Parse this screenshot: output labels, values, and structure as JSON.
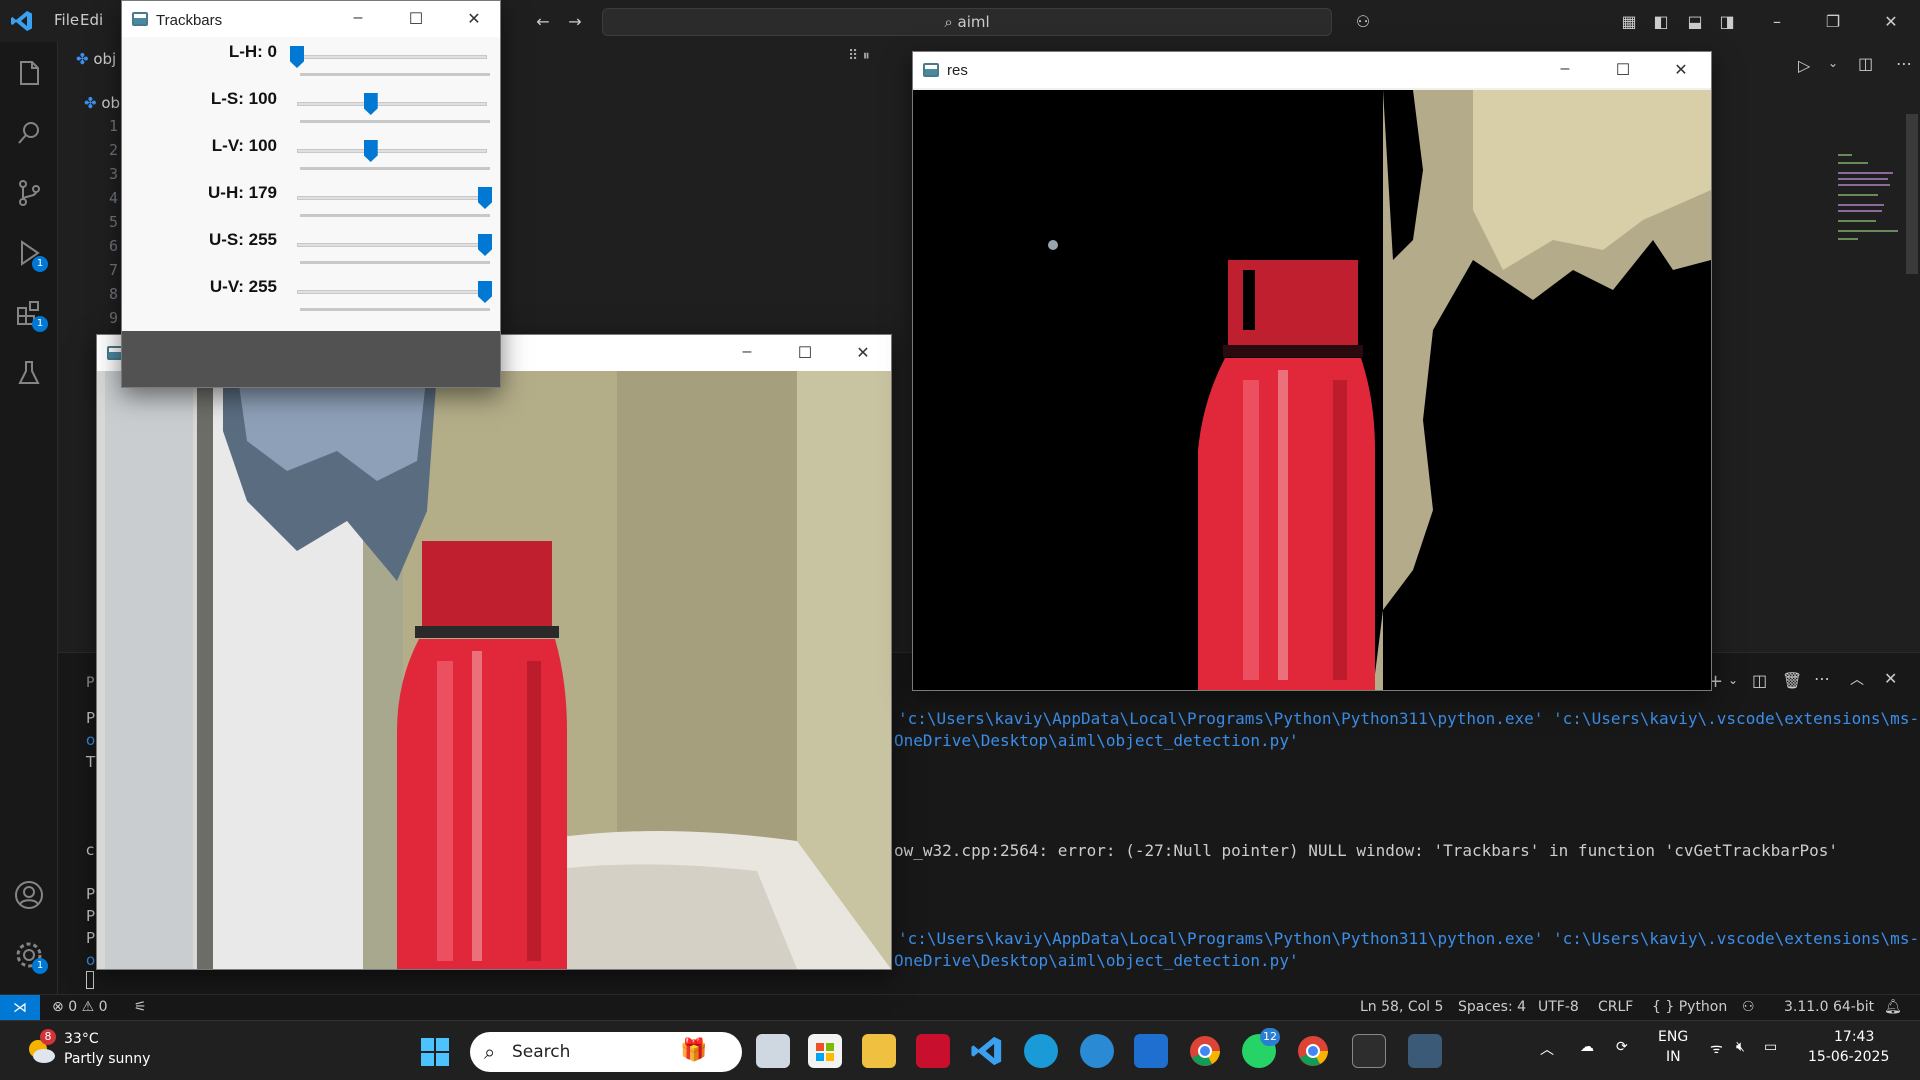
{
  "vscode": {
    "menu": [
      "File",
      "Edi"
    ],
    "search": "aiml",
    "tab_partial": "obj",
    "explorer_partial": "ob",
    "line_numbers": [
      "1",
      "2",
      "3",
      "4",
      "5",
      "6",
      "7",
      "8",
      "9"
    ],
    "badges": {
      "debug": "1",
      "extensions": "1",
      "settings": "1"
    },
    "panel_left_letters": [
      "P",
      "P",
      "o",
      "T",
      "c",
      "P",
      "P",
      "P",
      "o"
    ],
    "terminal": {
      "line1": "'c:\\Users\\kaviy\\AppData\\Local\\Programs\\Python\\Python311\\python.exe' 'c:\\Users\\kaviy\\.vscode\\extensions\\ms-pyth",
      "line2": "OneDrive\\Desktop\\aiml\\object_detection.py'",
      "error": "ow_w32.cpp:2564: error: (-27:Null pointer) NULL window: 'Trackbars' in function 'cvGetTrackbarPos'",
      "line3": "'c:\\Users\\kaviy\\AppData\\Local\\Programs\\Python\\Python311\\python.exe' 'c:\\Users\\kaviy\\.vscode\\extensions\\ms-pyth",
      "line4": "OneDrive\\Desktop\\aiml\\object_detection.py'"
    },
    "status": {
      "errors": "0",
      "warnings": "0",
      "position": "Ln 58, Col 5",
      "spaces": "Spaces: 4",
      "encoding": "UTF-8",
      "eol": "CRLF",
      "language": "{ } Python",
      "interpreter": "3.11.0 64-bit"
    }
  },
  "trackbars_window": {
    "title": "Trackbars",
    "sliders": [
      {
        "label": "L-H: 0",
        "value": 0,
        "max": 179
      },
      {
        "label": "L-S: 100",
        "value": 100,
        "max": 255
      },
      {
        "label": "L-V: 100",
        "value": 100,
        "max": 255
      },
      {
        "label": "U-H: 179",
        "value": 179,
        "max": 179
      },
      {
        "label": "U-S: 255",
        "value": 255,
        "max": 255
      },
      {
        "label": "U-V: 255",
        "value": 255,
        "max": 255
      }
    ]
  },
  "res_window": {
    "title": "res"
  },
  "frame_window": {
    "title": ""
  },
  "taskbar": {
    "weather_temp": "33°C",
    "weather_desc": "Partly sunny",
    "weather_badge": "8",
    "search_placeholder": "Search",
    "whatsapp_badge": "12",
    "language": "ENG",
    "region": "IN",
    "time": "17:43",
    "date": "15-06-2025"
  },
  "colors": {
    "accent": "#0078d4",
    "terminal_blue": "#3b8eea",
    "bottle_red": "#e0283a"
  }
}
